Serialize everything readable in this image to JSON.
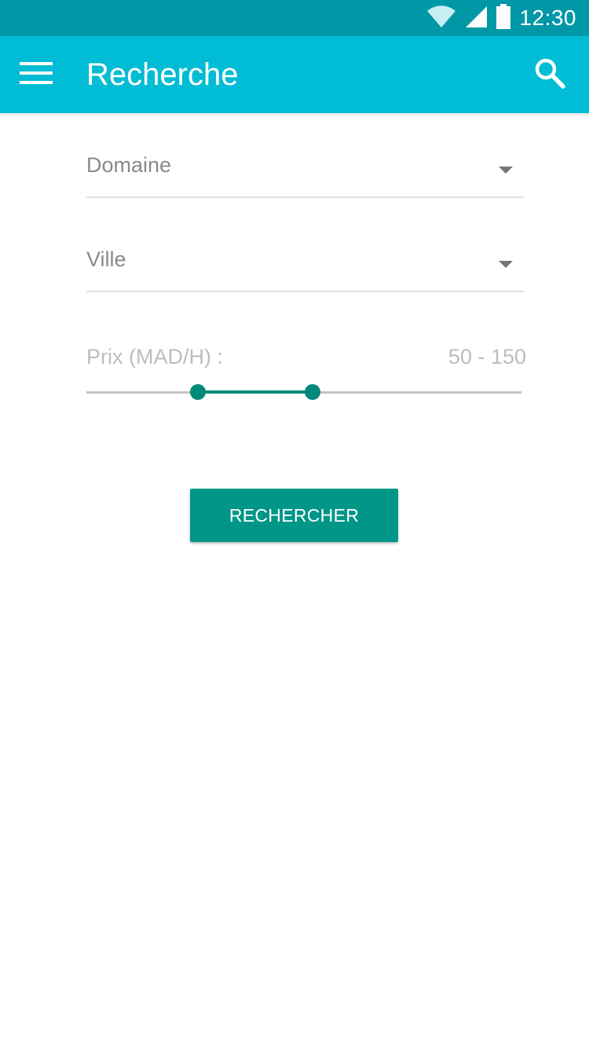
{
  "status_bar": {
    "time": "12:30",
    "icons": [
      "wifi-icon",
      "signal-icon",
      "battery-icon"
    ],
    "background": "#0097a7"
  },
  "app_bar": {
    "title": "Recherche",
    "background": "#00bcd4",
    "menu_icon": "menu-icon",
    "search_icon": "search-icon"
  },
  "form": {
    "domain_field": {
      "label": "Domaine",
      "icon": "dropdown-arrow-icon"
    },
    "city_field": {
      "label": "Ville",
      "icon": "dropdown-arrow-icon"
    },
    "price": {
      "label": "Prix (MAD/H) :",
      "range_text": "50 - 150",
      "min_value": 50,
      "max_value": 150,
      "low_fraction": 0.257,
      "high_fraction": 0.52,
      "accent": "#00897b"
    },
    "submit_label": "RECHERCHER",
    "button_color": "#009688"
  }
}
